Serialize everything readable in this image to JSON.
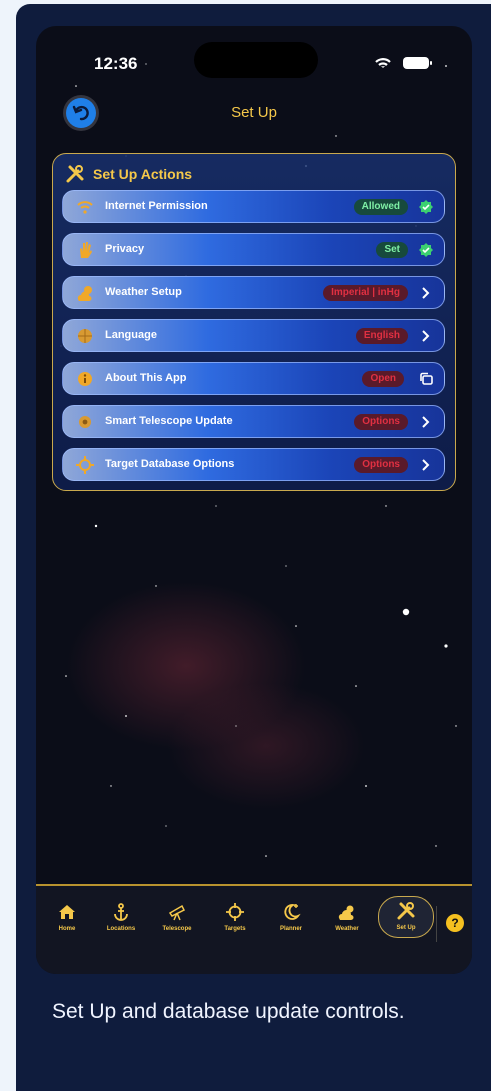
{
  "status_bar": {
    "time": "12:36"
  },
  "nav": {
    "title": "Set Up"
  },
  "panel": {
    "title": "Set Up Actions",
    "rows": [
      {
        "label": "Internet Permission",
        "badge": "Allowed",
        "badge_style": "green",
        "trail": "check-icon",
        "icon": "wifi-icon"
      },
      {
        "label": "Privacy",
        "badge": "Set",
        "badge_style": "green",
        "trail": "check-icon",
        "icon": "hand-icon"
      },
      {
        "label": "Weather Setup",
        "badge": "Imperial | inHg",
        "badge_style": "red",
        "trail": "chevron-right-icon",
        "icon": "cloud-sun-icon"
      },
      {
        "label": "Language",
        "badge": "English",
        "badge_style": "red",
        "trail": "chevron-right-icon",
        "icon": "globe-icon"
      },
      {
        "label": "About This App",
        "badge": "Open",
        "badge_style": "red",
        "trail": "external-copy-icon",
        "icon": "info-icon"
      },
      {
        "label": "Smart Telescope Update",
        "badge": "Options",
        "badge_style": "red",
        "trail": "chevron-right-icon",
        "icon": "gear-icon"
      },
      {
        "label": "Target Database Options",
        "badge": "Options",
        "badge_style": "red",
        "trail": "chevron-right-icon",
        "icon": "target-icon"
      }
    ]
  },
  "tabbar": {
    "items": [
      {
        "label": "Home",
        "icon": "house-icon"
      },
      {
        "label": "Locations",
        "icon": "anchor-icon"
      },
      {
        "label": "Telescope",
        "icon": "telescope-icon"
      },
      {
        "label": "Targets",
        "icon": "crosshair-icon"
      },
      {
        "label": "Planner",
        "icon": "moon-icon"
      },
      {
        "label": "Weather",
        "icon": "cloud-icon"
      },
      {
        "label": "Set Up",
        "icon": "tools-icon"
      }
    ],
    "help": "?"
  },
  "caption": "Set Up and database update controls.",
  "colors": {
    "accent": "#f5c84a",
    "green_badge": "#7ff0a6",
    "red_badge": "#e03042",
    "card_bg": "#0f1c3d"
  }
}
